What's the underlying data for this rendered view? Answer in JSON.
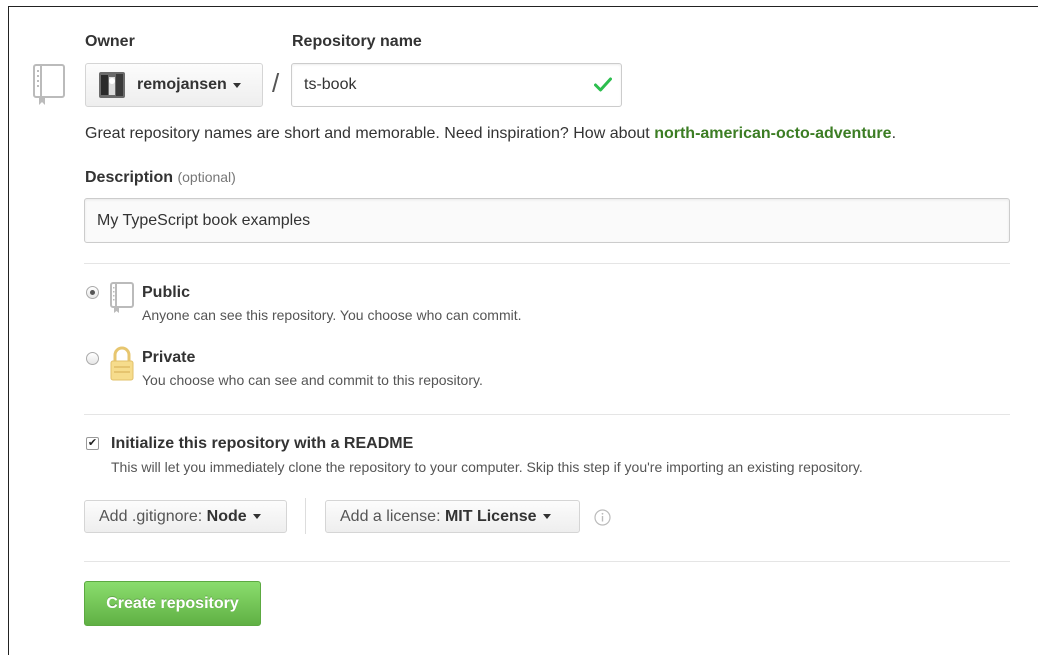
{
  "owner": {
    "label": "Owner",
    "value": "remojansen"
  },
  "repo_name": {
    "label": "Repository name",
    "value": "ts-book",
    "separator": "/"
  },
  "hint": {
    "text": "Great repository names are short and memorable. Need inspiration? How about ",
    "suggestion": "north-american-octo-adventure",
    "end": "."
  },
  "description": {
    "label": "Description",
    "optional": "(optional)",
    "value": "My TypeScript book examples"
  },
  "visibility": {
    "public_title": "Public",
    "public_desc": "Anyone can see this repository. You choose who can commit.",
    "private_title": "Private",
    "private_desc": "You choose who can see and commit to this repository.",
    "selected": "public"
  },
  "readme": {
    "checked": true,
    "title": "Initialize this repository with a README",
    "desc": "This will let you immediately clone the repository to your computer. Skip this step if you're importing an existing repository."
  },
  "gitignore": {
    "prefix": "Add .gitignore:",
    "value": "Node"
  },
  "license": {
    "prefix": "Add a license:",
    "value": "MIT License"
  },
  "create_button": "Create repository",
  "colors": {
    "suggestion": "#3c7d24",
    "create_button": "#60b044",
    "valid_check": "#2cbe4e"
  },
  "icons": [
    "repo-icon",
    "avatar",
    "check-icon",
    "book-icon",
    "lock-icon",
    "info-icon"
  ]
}
